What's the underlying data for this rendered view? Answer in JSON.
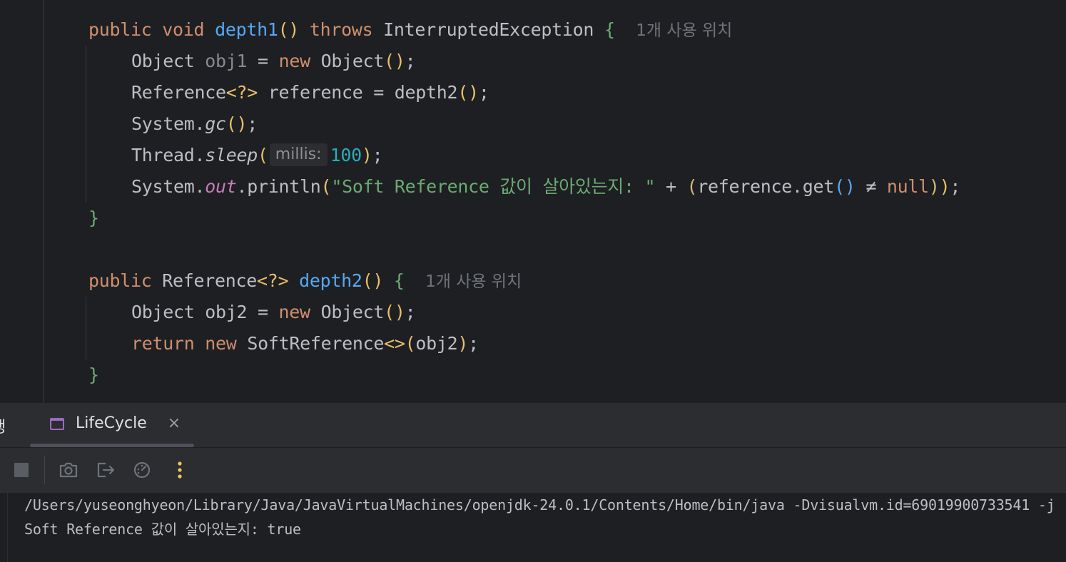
{
  "editor": {
    "method1": {
      "modifier": "public",
      "return_type": "void",
      "name": "depth1",
      "open_paren": "(",
      "close_paren": ")",
      "throws_kw": "throws",
      "exception": "InterruptedException",
      "open_brace": "{",
      "usage_hint": "1개 사용 위치",
      "line1": {
        "type": "Object",
        "var": "obj1",
        "eq": " = ",
        "new_kw": "new",
        "ctor": "Object",
        "parens": "()",
        "semi": ";"
      },
      "line2": {
        "type": "Reference",
        "generic": "<?>",
        "var_and_assign": " reference = depth2",
        "parens": "()",
        "semi": ";"
      },
      "line3": {
        "cls": "System.",
        "method": "gc",
        "parens": "()",
        "semi": ";"
      },
      "line4": {
        "cls": "Thread.",
        "method": "sleep",
        "open": "(",
        "param_hint": "millis:",
        "arg": "100",
        "close": ")",
        "semi": ";"
      },
      "line5": {
        "cls": "System.",
        "field": "out",
        "method": ".println",
        "open": "(",
        "string": "\"Soft Reference 값이 살아있는지: \"",
        "plus": " + ",
        "inner_open": "(",
        "call": "reference.get",
        "call_parens": "()",
        "neq": " ≠ ",
        "null_kw": "null",
        "inner_close": ")",
        "close": ")",
        "semi": ";"
      },
      "close_brace": "}"
    },
    "method2": {
      "modifier": "public",
      "return_type": "Reference",
      "generic": "<?>",
      "name": "depth2",
      "parens": "()",
      "open_brace": "{",
      "usage_hint": "1개 사용 위치",
      "line1": {
        "type": "Object",
        "rest": " obj2 = ",
        "new_kw": "new",
        "ctor": "Object",
        "parens": "()",
        "semi": ";"
      },
      "line2": {
        "return_kw": "return",
        "new_kw": "new",
        "ctor": "SoftReference",
        "diamond": "<>",
        "open": "(",
        "arg": "obj2",
        "close": ")",
        "semi": ";"
      },
      "close_brace": "}"
    }
  },
  "toolwindow": {
    "cutoff_label": "행",
    "tab_label": "LifeCycle",
    "tab_close": "×",
    "toolbar_icons": [
      "stop-icon",
      "camera-icon",
      "exit-icon",
      "dashboard-icon",
      "more-vertical-icon"
    ],
    "accent_color": "#f2c55c",
    "tab_icon_color": "#9c6bc4"
  },
  "console": {
    "lines": [
      "/Users/yuseonghyeon/Library/Java/JavaVirtualMachines/openjdk-24.0.1/Contents/Home/bin/java -Dvisualvm.id=69019900733541 -j",
      "Soft Reference 값이 살아있는지: true"
    ]
  }
}
